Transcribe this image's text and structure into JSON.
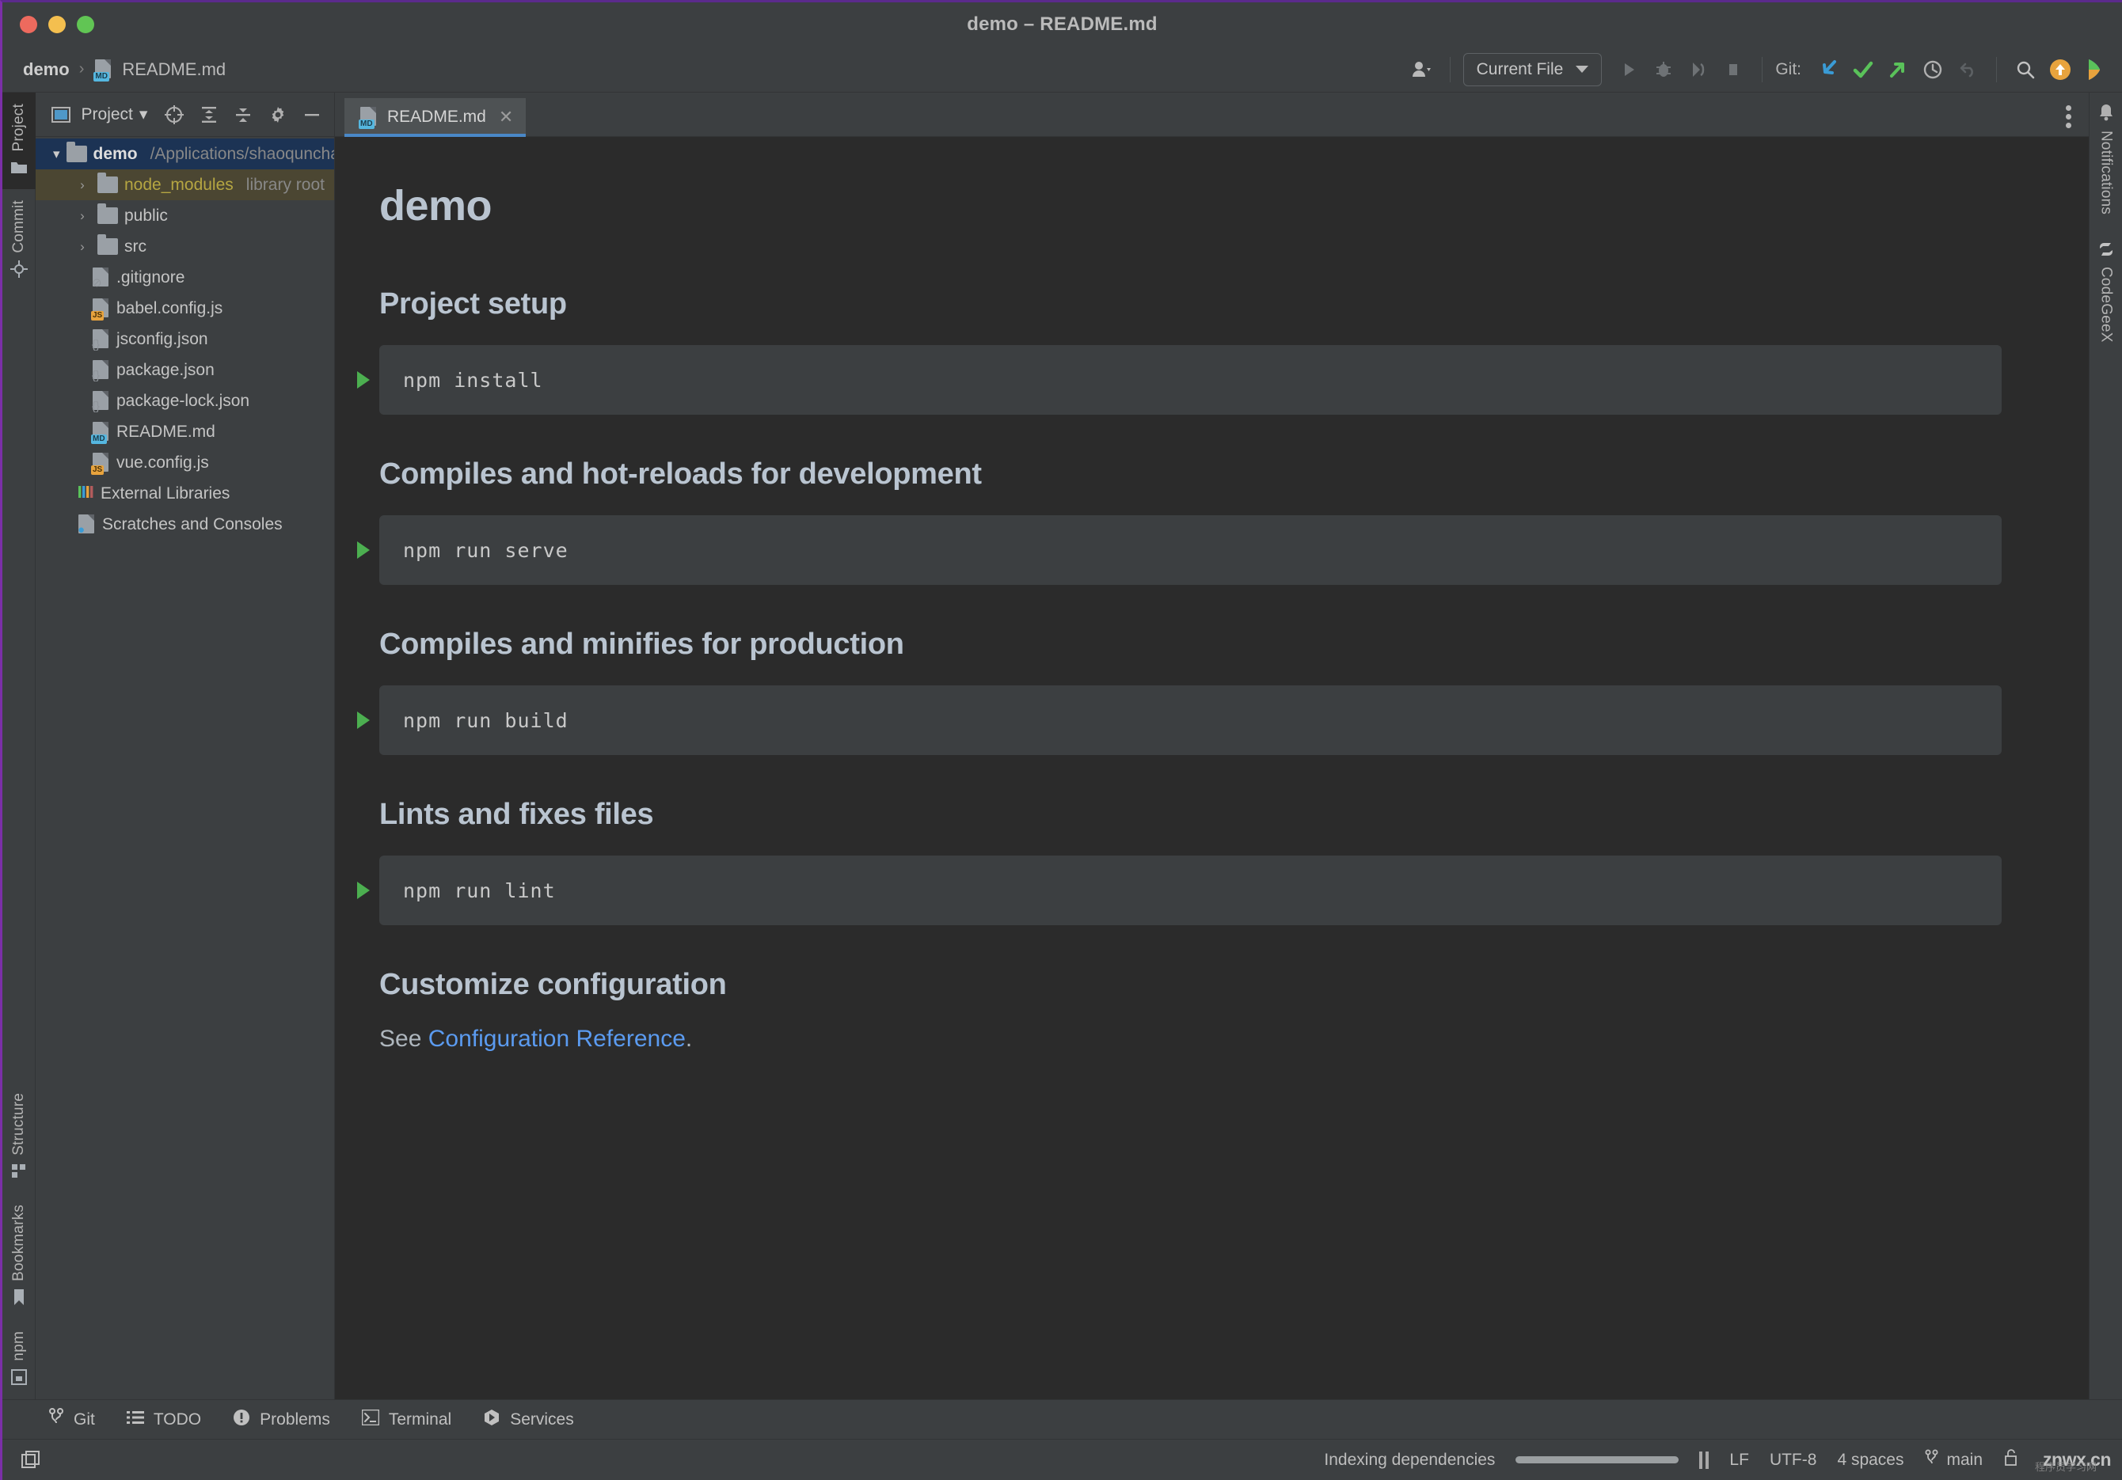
{
  "window": {
    "title": "demo – README.md",
    "traffic_lights": [
      "close-red",
      "minimize-yellow",
      "zoom-green"
    ]
  },
  "navbar": {
    "breadcrumb": {
      "project": "demo",
      "separator": "›",
      "file": "README.md"
    },
    "run_config": {
      "label": "Current File"
    },
    "git_label": "Git:",
    "icons": [
      "user-avatar-icon",
      "run-icon",
      "debug-icon",
      "run-with-coverage-icon",
      "stop-icon",
      "git-update-icon",
      "git-commit-icon",
      "git-push-icon",
      "git-history-icon",
      "git-rollback-icon",
      "search-icon",
      "updates-available-icon",
      "feedback-icon"
    ]
  },
  "left_strip": {
    "tabs": [
      {
        "label": "Project",
        "icon": "project-folder-icon",
        "active": true
      },
      {
        "label": "Commit",
        "icon": "commit-icon",
        "active": false
      }
    ],
    "bottom_tabs": [
      {
        "label": "Structure",
        "icon": "structure-icon"
      },
      {
        "label": "Bookmarks",
        "icon": "bookmark-icon"
      },
      {
        "label": "npm",
        "icon": "npm-icon"
      }
    ]
  },
  "right_strip": {
    "tabs": [
      {
        "label": "Notifications",
        "icon": "bell-icon"
      },
      {
        "label": "CodeGeeX",
        "icon": "codegeex-icon"
      }
    ]
  },
  "project_panel": {
    "title": "Project",
    "title_caret": "▾",
    "toolbar_icons": [
      "select-opened-file-icon",
      "expand-all-icon",
      "collapse-all-icon",
      "gear-icon",
      "hide-icon"
    ],
    "tree": [
      {
        "name": "demo",
        "hint": "/Applications/shaoqunchao/Codes/demo",
        "type": "folder-root",
        "arrow": "down",
        "selected": true,
        "indent": 1
      },
      {
        "name": "node_modules",
        "hint": "library root",
        "type": "folder",
        "arrow": "right",
        "library": true,
        "indent": 2
      },
      {
        "name": "public",
        "hint": "",
        "type": "folder",
        "arrow": "right",
        "indent": 2
      },
      {
        "name": "src",
        "hint": "",
        "type": "folder",
        "arrow": "right",
        "indent": 2
      },
      {
        "name": ".gitignore",
        "hint": "",
        "type": "file-gitignore",
        "arrow": "",
        "indent": 3
      },
      {
        "name": "babel.config.js",
        "hint": "",
        "type": "file-js",
        "arrow": "",
        "indent": 3
      },
      {
        "name": "jsconfig.json",
        "hint": "",
        "type": "file-json",
        "arrow": "",
        "indent": 3
      },
      {
        "name": "package.json",
        "hint": "",
        "type": "file-json",
        "arrow": "",
        "indent": 3
      },
      {
        "name": "package-lock.json",
        "hint": "",
        "type": "file-json",
        "arrow": "",
        "indent": 3
      },
      {
        "name": "README.md",
        "hint": "",
        "type": "file-md",
        "arrow": "",
        "indent": 3
      },
      {
        "name": "vue.config.js",
        "hint": "",
        "type": "file-js",
        "arrow": "",
        "indent": 3
      },
      {
        "name": "External Libraries",
        "hint": "",
        "type": "libraries",
        "arrow": "",
        "indent": 2
      },
      {
        "name": "Scratches and Consoles",
        "hint": "",
        "type": "scratches",
        "arrow": "",
        "indent": 2
      }
    ]
  },
  "editor": {
    "tabs": [
      {
        "label": "README.md",
        "icon": "markdown-file-icon",
        "active": true,
        "close": "✕"
      }
    ],
    "options_icon": "more-options-icon"
  },
  "markdown": {
    "title": "demo",
    "sections": [
      {
        "heading": "Project setup",
        "code": "npm install",
        "run": true
      },
      {
        "heading": "Compiles and hot-reloads for development",
        "code": "npm run serve",
        "run": true
      },
      {
        "heading": "Compiles and minifies for production",
        "code": "npm run build",
        "run": true
      },
      {
        "heading": "Lints and fixes files",
        "code": "npm run lint",
        "run": true
      }
    ],
    "customize": {
      "heading": "Customize configuration",
      "text_before": "See ",
      "link": "Configuration Reference",
      "text_after": "."
    }
  },
  "tool_windows": [
    {
      "label": "Git",
      "icon": "git-branch-icon"
    },
    {
      "label": "TODO",
      "icon": "todo-list-icon"
    },
    {
      "label": "Problems",
      "icon": "problems-icon"
    },
    {
      "label": "Terminal",
      "icon": "terminal-icon"
    },
    {
      "label": "Services",
      "icon": "services-icon"
    }
  ],
  "statusbar": {
    "left_icon": "toggle-toolwindows-icon",
    "indexing_text": "Indexing dependencies",
    "pause_icon": "pause-icon",
    "line_separator": "LF",
    "encoding": "UTF-8",
    "indent": "4 spaces",
    "branch": "main",
    "branch_icon": "git-branch-icon",
    "lock_icon": "unlocked-icon",
    "watermark": "znwx.cn",
    "watermark_sub": "程序员学习网"
  },
  "colors": {
    "bg_panel": "#3c3f41",
    "bg_editor": "#2b2b2b",
    "accent_blue": "#4a88c7",
    "link_blue": "#5b9bf0",
    "run_green": "#4caf50",
    "selected_row": "#1c3354",
    "library_row": "#4b4632",
    "heading": "#b9c4d0"
  }
}
